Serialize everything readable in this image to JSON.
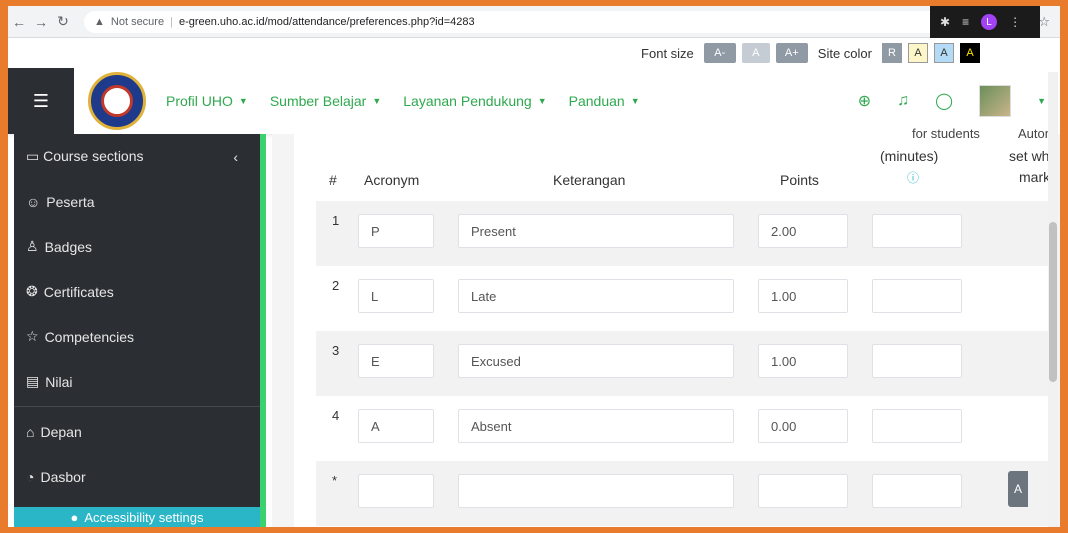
{
  "browser": {
    "security_label": "Not secure",
    "url": "e-green.uho.ac.id/mod/attendance/preferences.php?id=4283",
    "profile_initial": "L"
  },
  "accessibility": {
    "font_size_label": "Font size",
    "font_dec": "A-",
    "font_normal": "A",
    "font_inc": "A+",
    "site_color_label": "Site color",
    "color_reset": "R",
    "color_a1": "A",
    "color_a2": "A",
    "color_a3": "A"
  },
  "navbar": {
    "menu": [
      {
        "label": "Profil UHO"
      },
      {
        "label": "Sumber Belajar"
      },
      {
        "label": "Layanan Pendukung"
      },
      {
        "label": "Panduan"
      }
    ]
  },
  "sidebar": {
    "items": [
      {
        "label": "Course sections"
      },
      {
        "label": "Peserta"
      },
      {
        "label": "Badges"
      },
      {
        "label": "Certificates"
      },
      {
        "label": "Competencies"
      },
      {
        "label": "Nilai"
      },
      {
        "label": "Depan"
      },
      {
        "label": "Dasbor"
      }
    ],
    "accessibility_button": "Accessibility settings"
  },
  "table": {
    "headers": {
      "num": "#",
      "acronym": "Acronym",
      "description": "Keterangan",
      "points": "Points",
      "minutes_top": "for students",
      "minutes": "(minutes)",
      "auto_top": "Autom",
      "auto_mid": "set wh",
      "auto_bot": "mark"
    },
    "rows": [
      {
        "num": "1",
        "acronym": "P",
        "description": "Present",
        "points": "2.00"
      },
      {
        "num": "2",
        "acronym": "L",
        "description": "Late",
        "points": "1.00"
      },
      {
        "num": "3",
        "acronym": "E",
        "description": "Excused",
        "points": "1.00"
      },
      {
        "num": "4",
        "acronym": "A",
        "description": "Absent",
        "points": "0.00"
      },
      {
        "num": "*",
        "acronym": "",
        "description": "",
        "points": ""
      }
    ],
    "add_label": "A"
  },
  "colors": {
    "accent_green": "#2fa94e",
    "sidebar_bg": "#2b2f33",
    "sidebar_border": "#3bd16f",
    "frame_border": "#e87c2c"
  }
}
